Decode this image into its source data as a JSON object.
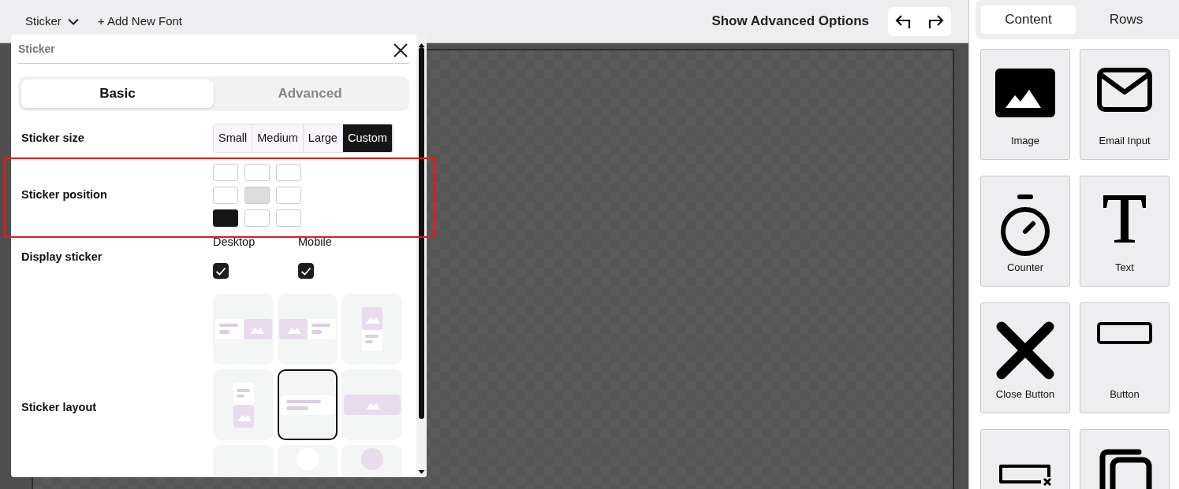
{
  "toolbar": {
    "menu": "Sticker",
    "add_font": "+ Add New Font",
    "advanced_options": "Show Advanced Options"
  },
  "panel": {
    "title": "Sticker",
    "tabs": [
      {
        "label": "Basic",
        "selected": true
      },
      {
        "label": "Advanced",
        "selected": false
      }
    ],
    "size": {
      "label": "Sticker size",
      "options": [
        {
          "label": "Small",
          "selected": false
        },
        {
          "label": "Medium",
          "selected": false
        },
        {
          "label": "Large",
          "selected": false
        },
        {
          "label": "Custom",
          "selected": true
        }
      ]
    },
    "position": {
      "label": "Sticker position",
      "cells": [
        {
          "selected": false,
          "disabled": false
        },
        {
          "selected": false,
          "disabled": false
        },
        {
          "selected": false,
          "disabled": false
        },
        {
          "selected": false,
          "disabled": false
        },
        {
          "selected": false,
          "disabled": true
        },
        {
          "selected": false,
          "disabled": false
        },
        {
          "selected": true,
          "disabled": false
        },
        {
          "selected": false,
          "disabled": false
        },
        {
          "selected": false,
          "disabled": false
        }
      ]
    },
    "display": {
      "label": "Display sticker",
      "options": [
        {
          "label": "Desktop",
          "checked": true
        },
        {
          "label": "Mobile",
          "checked": true
        }
      ]
    },
    "layout": {
      "label": "Sticker layout",
      "options": [
        {
          "kind": "text-image",
          "selected": false
        },
        {
          "kind": "image-text",
          "selected": false
        },
        {
          "kind": "image-top",
          "selected": false
        },
        {
          "kind": "text-top",
          "selected": false
        },
        {
          "kind": "text-only",
          "selected": true
        },
        {
          "kind": "image-only",
          "selected": false
        },
        {
          "kind": "blank",
          "selected": false
        },
        {
          "kind": "circle-light",
          "selected": false
        },
        {
          "kind": "circle",
          "selected": false
        }
      ]
    }
  },
  "sidebar": {
    "tabs": [
      {
        "label": "Content",
        "selected": true
      },
      {
        "label": "Rows",
        "selected": false
      }
    ],
    "items": [
      {
        "kind": "image",
        "label": "Image"
      },
      {
        "kind": "email",
        "label": "Email Input"
      },
      {
        "kind": "counter",
        "label": "Counter"
      },
      {
        "kind": "text",
        "label": "Text"
      },
      {
        "kind": "close",
        "label": "Close Button"
      },
      {
        "kind": "button",
        "label": "Button"
      },
      {
        "kind": "input-close"
      },
      {
        "kind": "copy"
      }
    ]
  }
}
